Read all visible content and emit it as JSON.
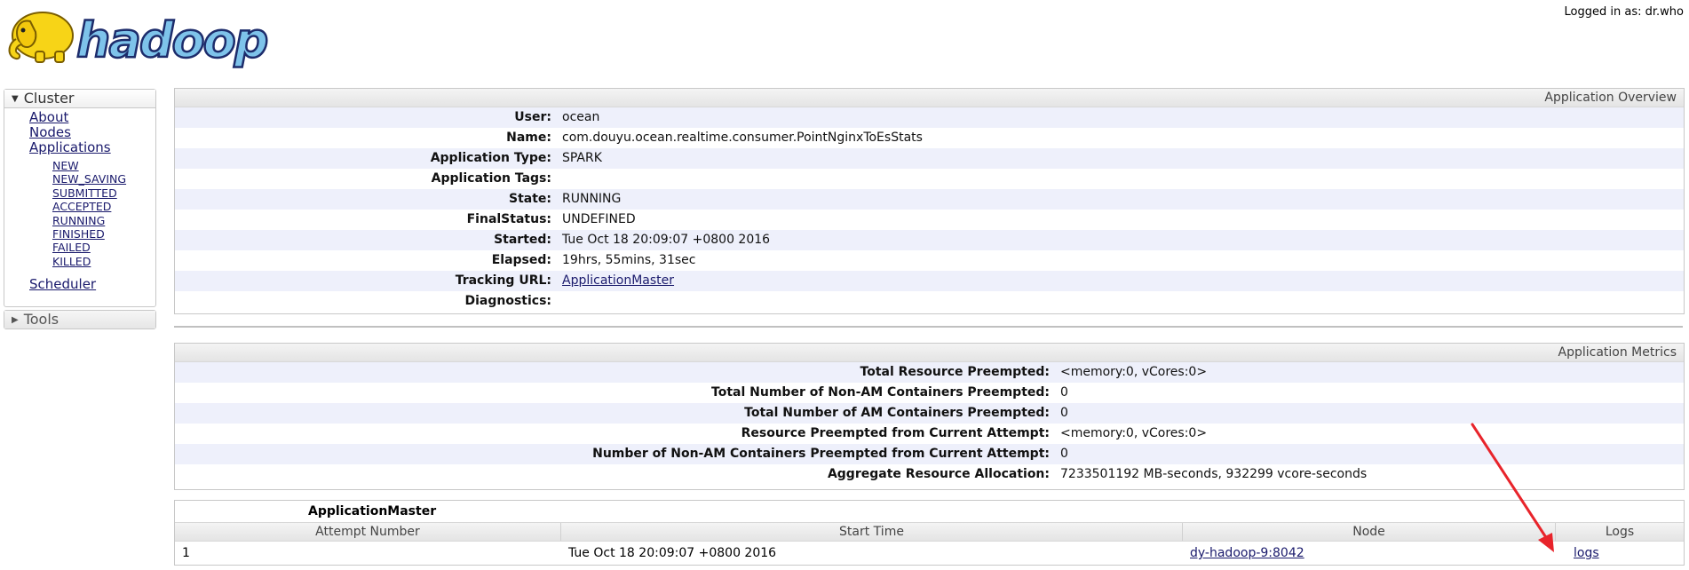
{
  "header": {
    "logo_text": "hadoop",
    "logged_in": "Logged in as: dr.who"
  },
  "sidebar": {
    "cluster": {
      "title": "Cluster",
      "links": [
        {
          "label": "About"
        },
        {
          "label": "Nodes"
        },
        {
          "label": "Applications"
        }
      ],
      "app_states": [
        {
          "label": "NEW"
        },
        {
          "label": "NEW_SAVING"
        },
        {
          "label": "SUBMITTED"
        },
        {
          "label": "ACCEPTED"
        },
        {
          "label": "RUNNING"
        },
        {
          "label": "FINISHED"
        },
        {
          "label": "FAILED"
        },
        {
          "label": "KILLED"
        }
      ],
      "scheduler": "Scheduler"
    },
    "tools": {
      "title": "Tools"
    }
  },
  "overview": {
    "title": "Application Overview",
    "rows": [
      {
        "label": "User:",
        "value": "ocean"
      },
      {
        "label": "Name:",
        "value": "com.douyu.ocean.realtime.consumer.PointNginxToEsStats"
      },
      {
        "label": "Application Type:",
        "value": "SPARK"
      },
      {
        "label": "Application Tags:",
        "value": ""
      },
      {
        "label": "State:",
        "value": "RUNNING"
      },
      {
        "label": "FinalStatus:",
        "value": "UNDEFINED"
      },
      {
        "label": "Started:",
        "value": "Tue Oct 18 20:09:07 +0800 2016"
      },
      {
        "label": "Elapsed:",
        "value": "19hrs, 55mins, 31sec"
      },
      {
        "label": "Tracking URL:",
        "value": "ApplicationMaster"
      },
      {
        "label": "Diagnostics:",
        "value": ""
      }
    ]
  },
  "metrics": {
    "title": "Application Metrics",
    "rows": [
      {
        "label": "Total Resource Preempted:",
        "value": "<memory:0, vCores:0>"
      },
      {
        "label": "Total Number of Non-AM Containers Preempted:",
        "value": "0"
      },
      {
        "label": "Total Number of AM Containers Preempted:",
        "value": "0"
      },
      {
        "label": "Resource Preempted from Current Attempt:",
        "value": "<memory:0, vCores:0>"
      },
      {
        "label": "Number of Non-AM Containers Preempted from Current Attempt:",
        "value": "0"
      },
      {
        "label": "Aggregate Resource Allocation:",
        "value": "7233501192 MB-seconds, 932299 vcore-seconds"
      }
    ]
  },
  "attempts": {
    "caption": "ApplicationMaster",
    "columns": [
      "Attempt Number",
      "Start Time",
      "Node",
      "Logs"
    ],
    "rows": [
      {
        "attempt": "1",
        "start": "Tue Oct 18 20:09:07 +0800 2016",
        "node": "dy-hadoop-9:8042",
        "logs": "logs"
      }
    ]
  },
  "colors": {
    "link": "#1a1a6c",
    "row_alt": "#eef0fb",
    "annotation_arrow": "#e8242b",
    "logo_yellow": "#f7d417",
    "logo_text": "#2d3f8f"
  },
  "icons": {
    "cluster_toggle": "triangle-down-icon",
    "tools_toggle": "triangle-right-icon",
    "logo": "hadoop-elephant-logo"
  }
}
